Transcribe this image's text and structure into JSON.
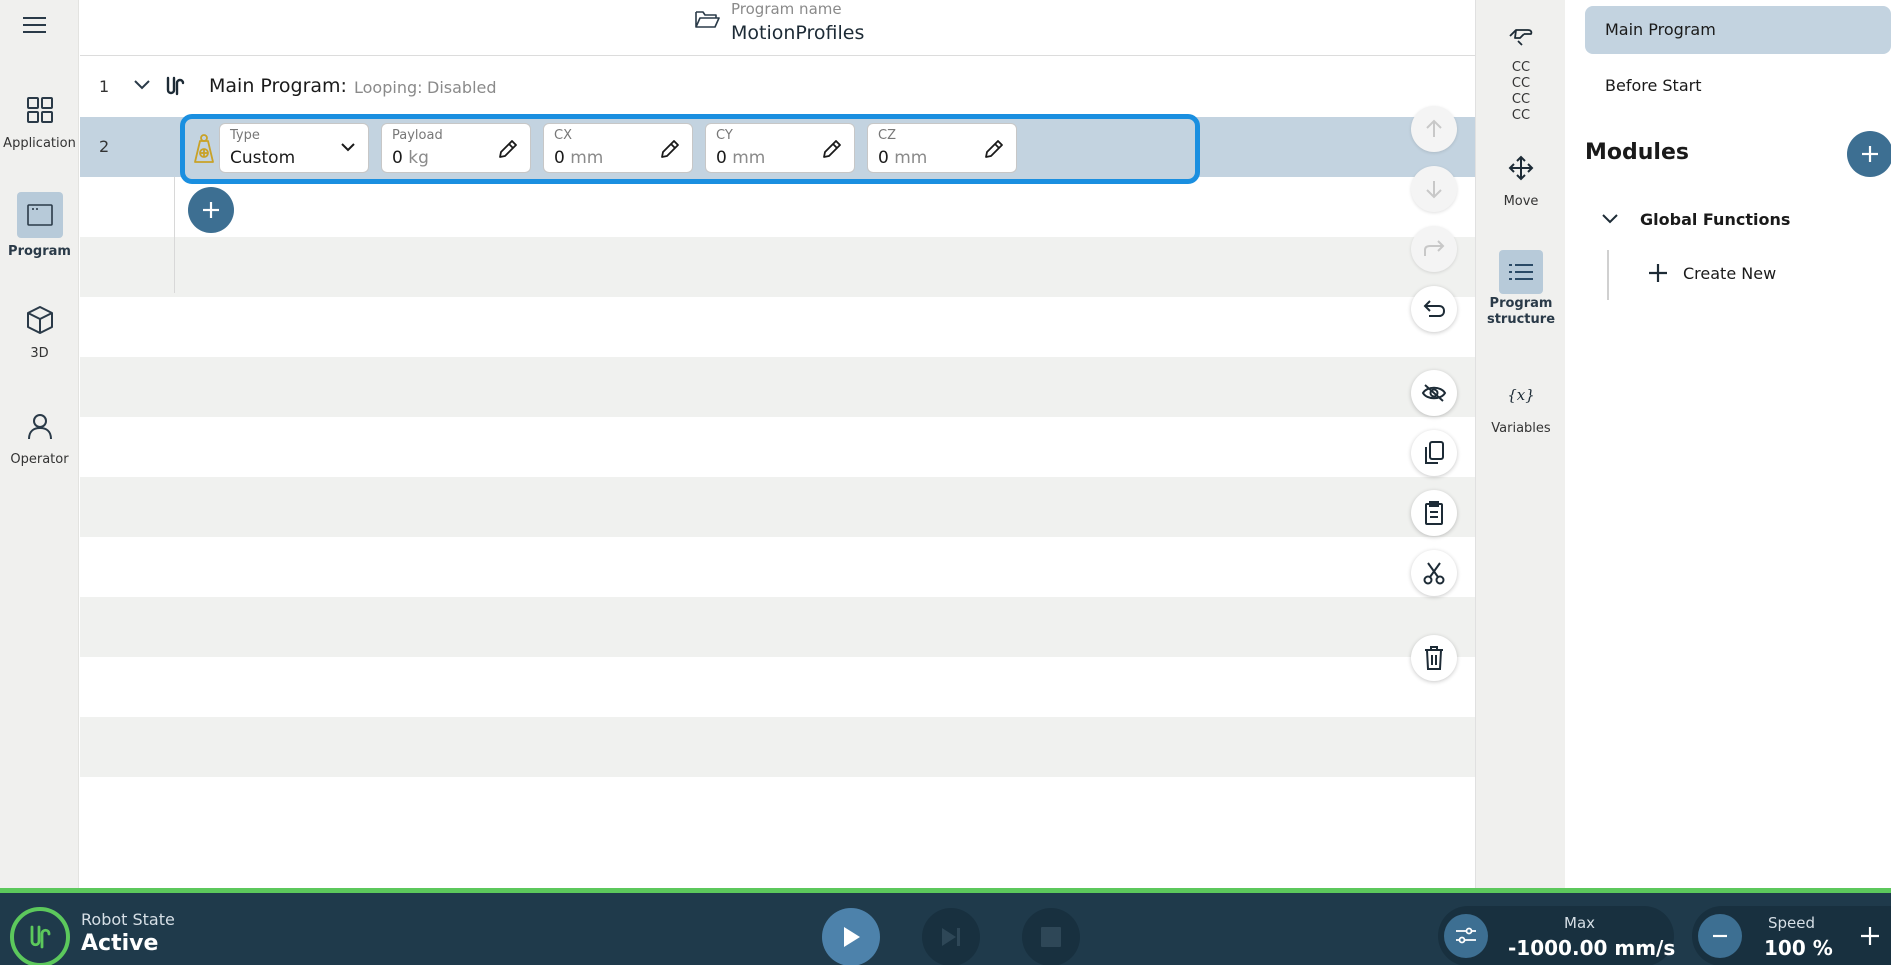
{
  "left_nav": {
    "items": [
      {
        "label": "Application",
        "icon": "grid-icon"
      },
      {
        "label": "Program",
        "icon": "window-icon"
      },
      {
        "label": "3D",
        "icon": "cube-icon"
      },
      {
        "label": "Operator",
        "icon": "person-icon"
      }
    ],
    "active": "Program"
  },
  "header": {
    "subtitle": "Program name",
    "program_name": "MotionProfiles"
  },
  "program_tree": {
    "line1": {
      "num": "1",
      "title": "Main Program:",
      "looping_label": "Looping:",
      "looping_value": "Disabled"
    },
    "line2": {
      "num": "2",
      "node_icon": "payload-weight-icon",
      "fields": {
        "type": {
          "label": "Type",
          "value": "Custom"
        },
        "payload": {
          "label": "Payload",
          "value": "0",
          "unit": "kg"
        },
        "cx": {
          "label": "CX",
          "value": "0",
          "unit": "mm"
        },
        "cy": {
          "label": "CY",
          "value": "0",
          "unit": "mm"
        },
        "cz": {
          "label": "CZ",
          "value": "0",
          "unit": "mm"
        }
      }
    }
  },
  "tool_strip": {
    "items": [
      {
        "label": "CC CC CC CC",
        "icon": "hand-freedrive-icon"
      },
      {
        "label": "Move",
        "icon": "move-arrows-icon"
      },
      {
        "label": "Program structure",
        "icon": "list-icon"
      },
      {
        "label": "Variables",
        "icon": "variables-icon"
      }
    ],
    "active": "Program structure"
  },
  "right_panel": {
    "main_program": "Main Program",
    "before_start": "Before Start",
    "modules_heading": "Modules",
    "global_functions": "Global Functions",
    "create_new": "Create New"
  },
  "bottom_bar": {
    "robot_state_label": "Robot State",
    "robot_state_value": "Active",
    "max_label": "Max",
    "max_value": "-1000.00 mm/s",
    "speed_label": "Speed",
    "speed_value": "100 %"
  },
  "colors": {
    "accent": "#3d6f92",
    "selection": "#c3d3e0",
    "highlight_border": "#1a8fe0",
    "status_green": "#5cc85c",
    "bottom_bar": "#1f3a4b"
  }
}
